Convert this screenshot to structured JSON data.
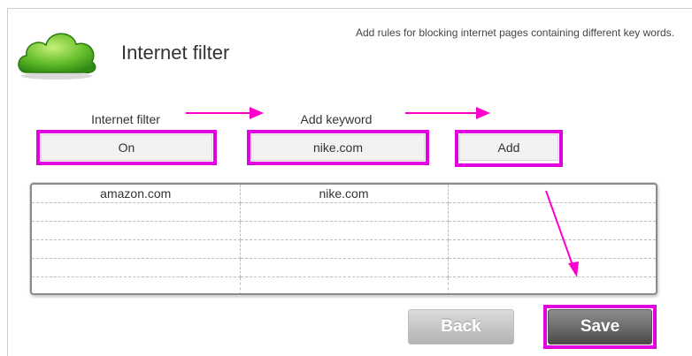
{
  "header": {
    "title": "Internet filter",
    "description": "Add rules for blocking internet pages containing different key words."
  },
  "form": {
    "filter_label": "Internet filter",
    "filter_value": "On",
    "keyword_label": "Add keyword",
    "keyword_value": "nike.com",
    "add_label": "Add"
  },
  "keywords_table": {
    "rows": [
      [
        "amazon.com",
        "nike.com",
        ""
      ],
      [
        "",
        "",
        ""
      ],
      [
        "",
        "",
        ""
      ],
      [
        "",
        "",
        ""
      ],
      [
        "",
        "",
        ""
      ],
      [
        "",
        "",
        ""
      ]
    ]
  },
  "buttons": {
    "back_label": "Back",
    "save_label": "Save"
  },
  "colors": {
    "highlight": "#e000e0",
    "logo_green": "#5cb82a"
  },
  "icons": {
    "logo": "cloud-logo-icon",
    "annotation": "arrow-icon"
  }
}
